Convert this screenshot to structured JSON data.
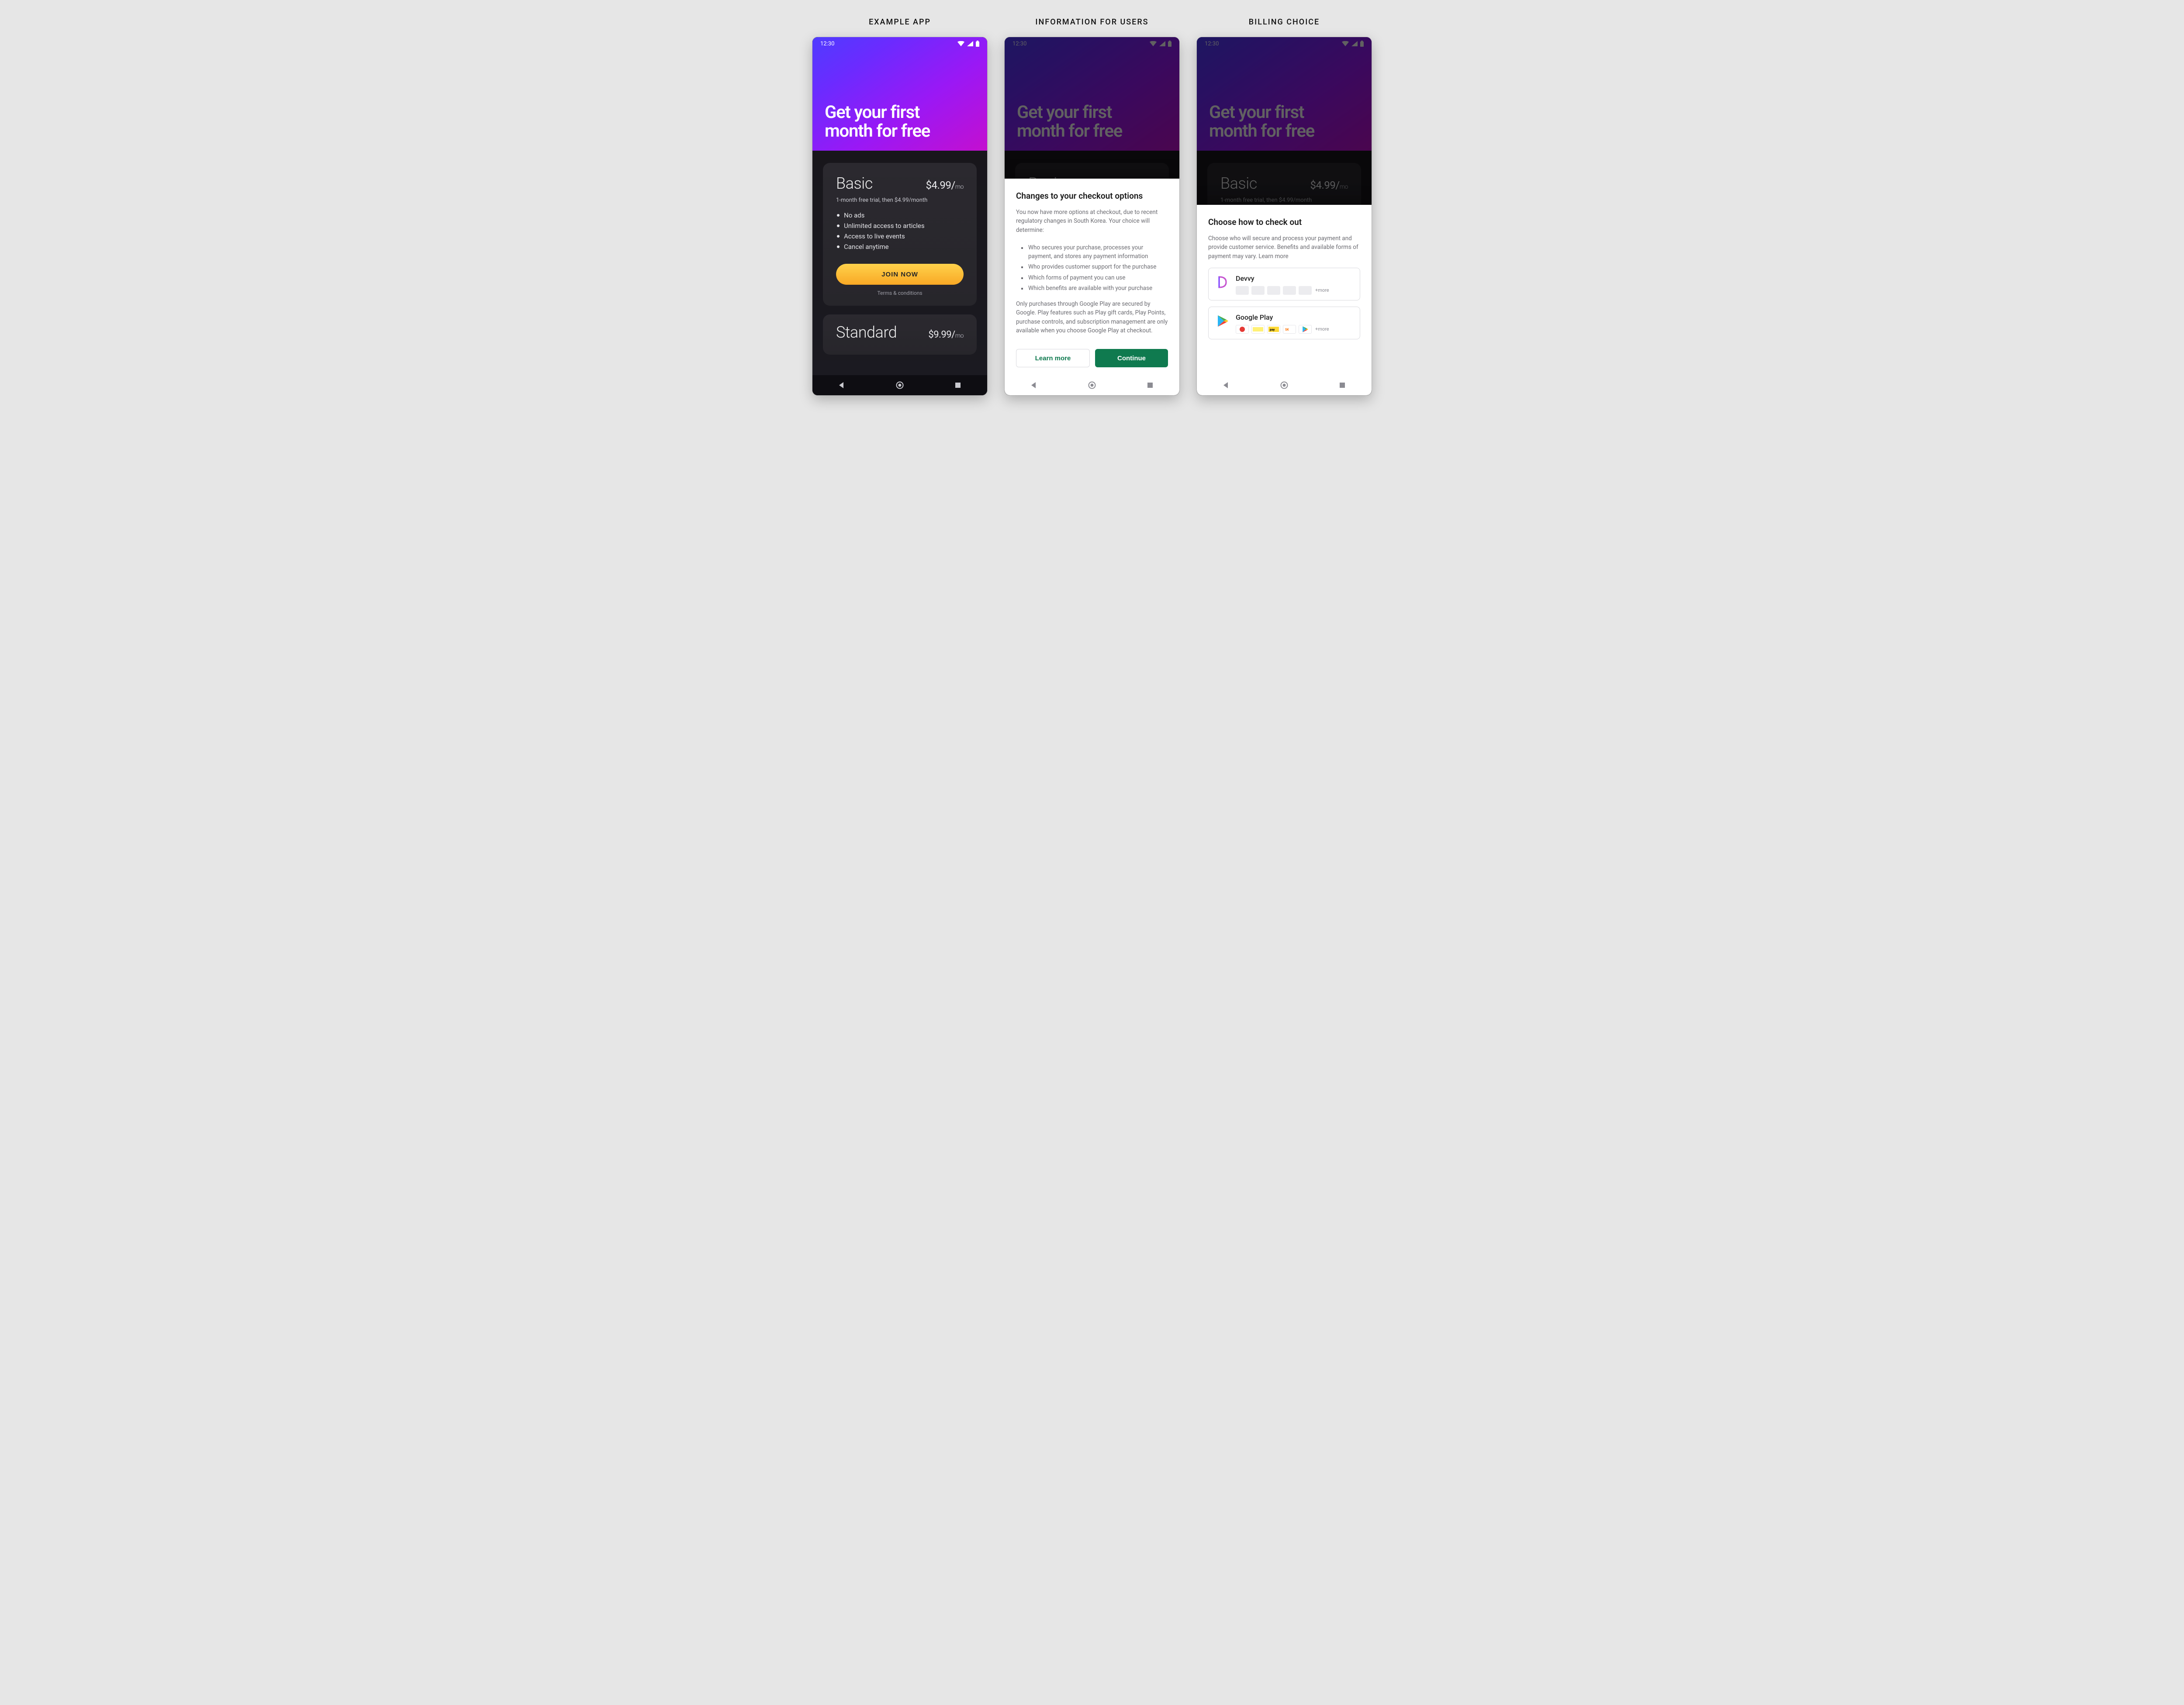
{
  "columns": [
    "EXAMPLE APP",
    "INFORMATION FOR USERS",
    "BILLING CHOICE"
  ],
  "status": {
    "time": "12:30"
  },
  "hero": {
    "title_line1": "Get your first",
    "title_line2": "month for free"
  },
  "plans": {
    "basic": {
      "name": "Basic",
      "price": "$4.99/",
      "per": "mo",
      "sub": "1-month free trial, then $4.99/month",
      "features": [
        "No ads",
        "Unlimited access to articles",
        "Access to live events",
        "Cancel anytime"
      ],
      "cta": "JOIN NOW",
      "tnc": "Terms & conditions"
    },
    "standard": {
      "name": "Standard",
      "price": "$9.99/",
      "per": "mo"
    }
  },
  "info_sheet": {
    "title": "Changes to your checkout options",
    "intro": "You now have more options at checkout, due to recent regulatory changes in South Korea. Your choice will determine:",
    "bullets": [
      "Who secures your purchase, processes your payment, and stores any payment information",
      "Who provides customer support for the purchase",
      "Which forms of payment you can use",
      "Which benefits are available with your purchase"
    ],
    "note": "Only purchases through Google Play are secured by Google. Play features such as Play gift cards, Play Points, purchase controls, and subscription management are only available when you choose Google Play at checkout.",
    "learn_more": "Learn more",
    "continue": "Continue"
  },
  "choice_sheet": {
    "title": "Choose how to check out",
    "desc": "Choose who will secure and process your payment and provide customer service. Benefits and available forms of payment may vary. Learn more",
    "devvy": {
      "name": "Devvy",
      "more": "+more"
    },
    "google": {
      "name": "Google Play",
      "more": "+more"
    }
  }
}
